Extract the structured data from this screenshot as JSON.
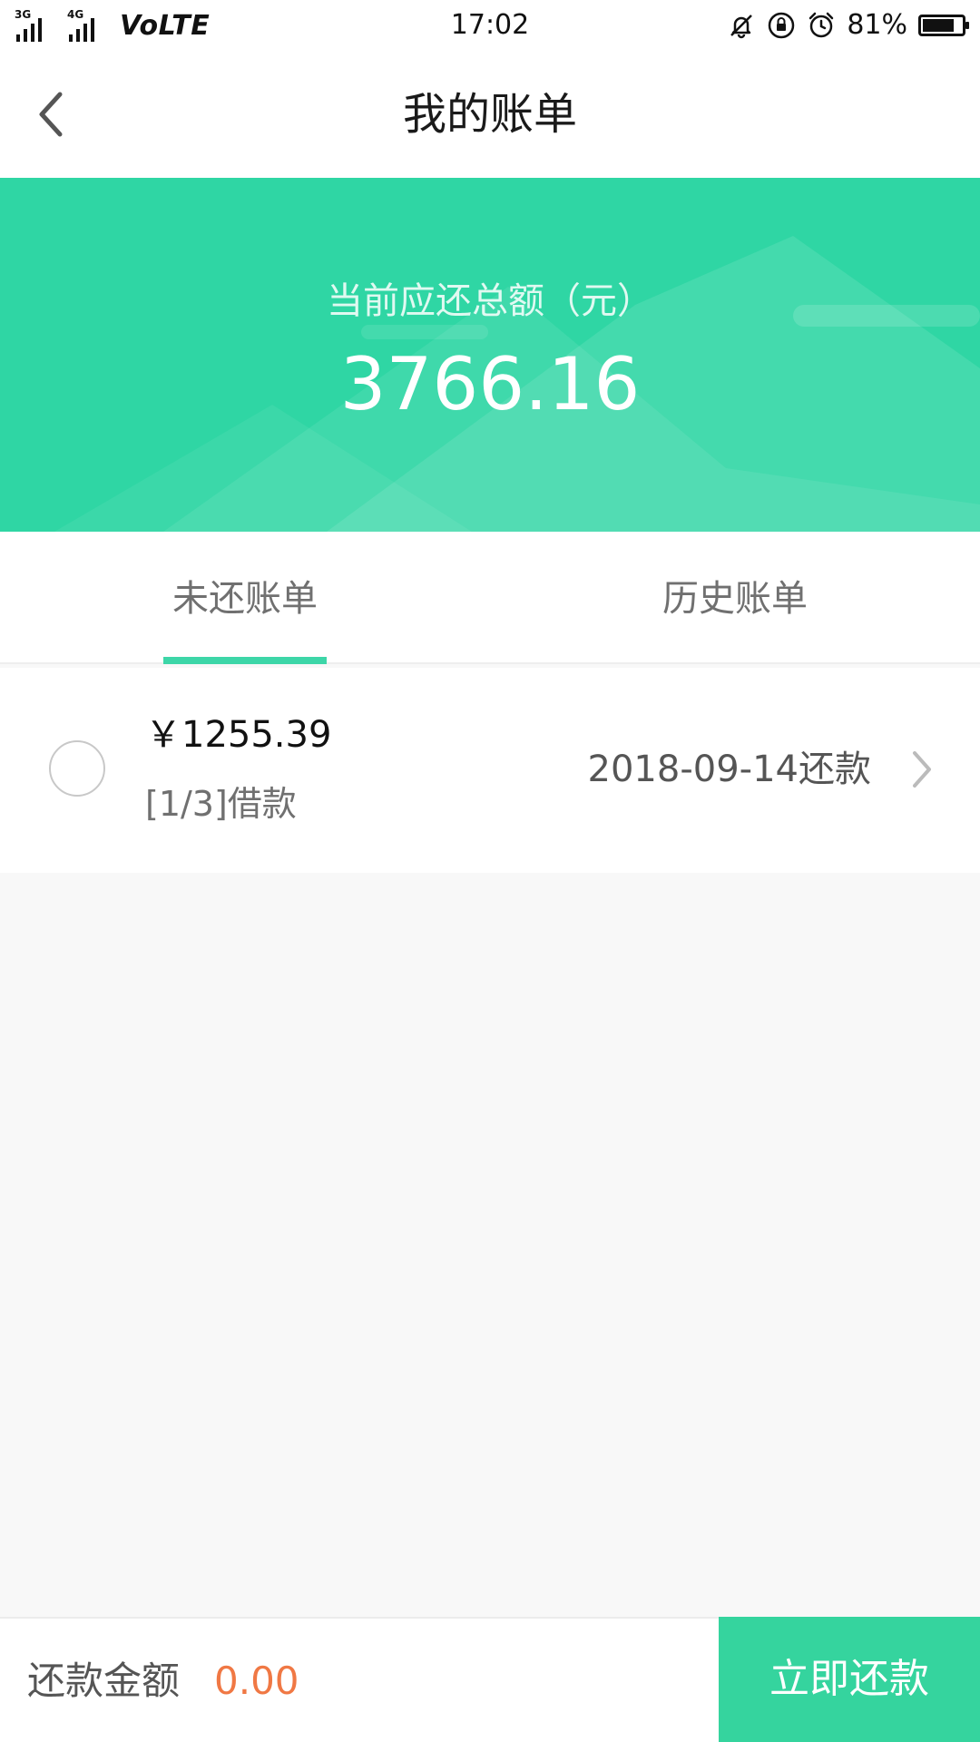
{
  "status_bar": {
    "network_tag_1": "3G",
    "network_tag_2": "4G",
    "volte": "VoLTE",
    "time": "17:02",
    "battery_percent": "81%",
    "battery_level": 0.81,
    "icons": [
      "mute-bell-icon",
      "rotation-lock-icon",
      "alarm-icon",
      "battery-icon"
    ]
  },
  "header": {
    "back_icon": "chevron-left-icon",
    "title": "我的账单"
  },
  "summary": {
    "label": "当前应还总额（元）",
    "amount": "3766.16"
  },
  "tabs": [
    {
      "label": "未还账单",
      "active": true
    },
    {
      "label": "历史账单",
      "active": false
    }
  ],
  "bills": [
    {
      "amount": "￥1255.39",
      "description": "[1/3]借款",
      "due": "2018-09-14还款",
      "selected": false
    }
  ],
  "footer": {
    "label": "还款金额",
    "amount": "0.00",
    "pay_button": "立即还款"
  },
  "colors": {
    "accent": "#35d49e",
    "banner": "#2fd6a4",
    "amount_highlight": "#f07844",
    "tab_indicator": "#3dd6a8"
  }
}
